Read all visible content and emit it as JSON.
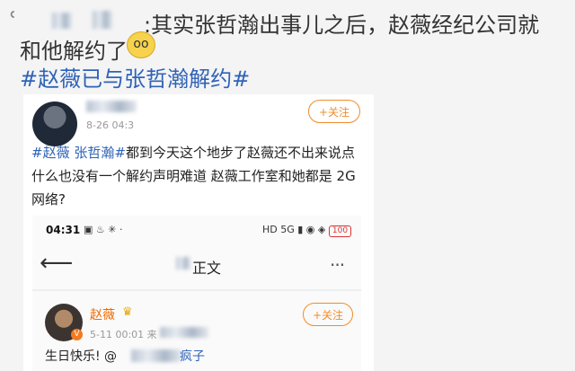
{
  "caption": {
    "line1": ":其实张哲瀚出事儿之后，赵薇经纪公司就",
    "line2": "和他解约了",
    "emoji": "oo",
    "hashtag": "#赵薇已与张哲瀚解约#"
  },
  "post": {
    "date": "8-26 04:3",
    "follow_label": "+关注",
    "tag1": "#赵薇",
    "tag2": "张哲瀚#",
    "body": "都到今天这个地步了赵薇还不出来说点什么也没有一个解约声明难道 赵薇工作室和她都是 2G 网络?"
  },
  "inner": {
    "status_time": "04:31",
    "status_icons": "▣ ♨ ✳ ·",
    "status_right": "HD 5G ▮ ◉ ◈ 100",
    "battery": "100",
    "nav_title": "正文",
    "more": "···",
    "comment": {
      "name": "赵薇",
      "vbadge": "V",
      "meta": "5-11 00:01  来",
      "follow_label": "+关注",
      "text_start": "生日快乐! @",
      "mention_end": "疯子"
    }
  },
  "colors": {
    "link": "#2f63b6",
    "follow": "#f08c2a",
    "name": "#f06a00"
  }
}
